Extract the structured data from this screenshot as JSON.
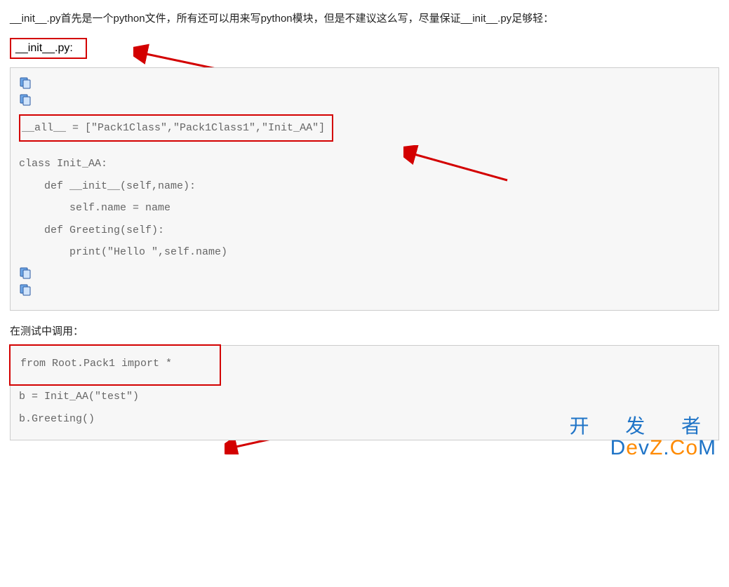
{
  "intro": "__init__.py首先是一个python文件，所有还可以用来写python模块，但是不建议这么写，尽量保证__init__.py足够轻：",
  "heading1": "__init__.py:",
  "icons": {
    "copy": "copy-icon"
  },
  "code1": {
    "all_line": "__all__ = [\"Pack1Class\",\"Pack1Class1\",\"Init_AA\"]",
    "l1": "class Init_AA:",
    "l2": "    def __init__(self,name):",
    "l3": "        self.name = name",
    "l4": "",
    "l5": "    def Greeting(self):",
    "l6": "        print(\"Hello \",self.name)"
  },
  "subheading": "在测试中调用：",
  "code2": {
    "l1": "from Root.Pack1 import *",
    "l2": "",
    "l3": "b = Init_AA(\"test\")",
    "l4": "",
    "l5": "b.Greeting()"
  },
  "watermark": {
    "cn": "开 发 者",
    "en_parts": [
      "D",
      "e",
      "v",
      "Z",
      ".",
      "C",
      "o",
      "M"
    ]
  }
}
